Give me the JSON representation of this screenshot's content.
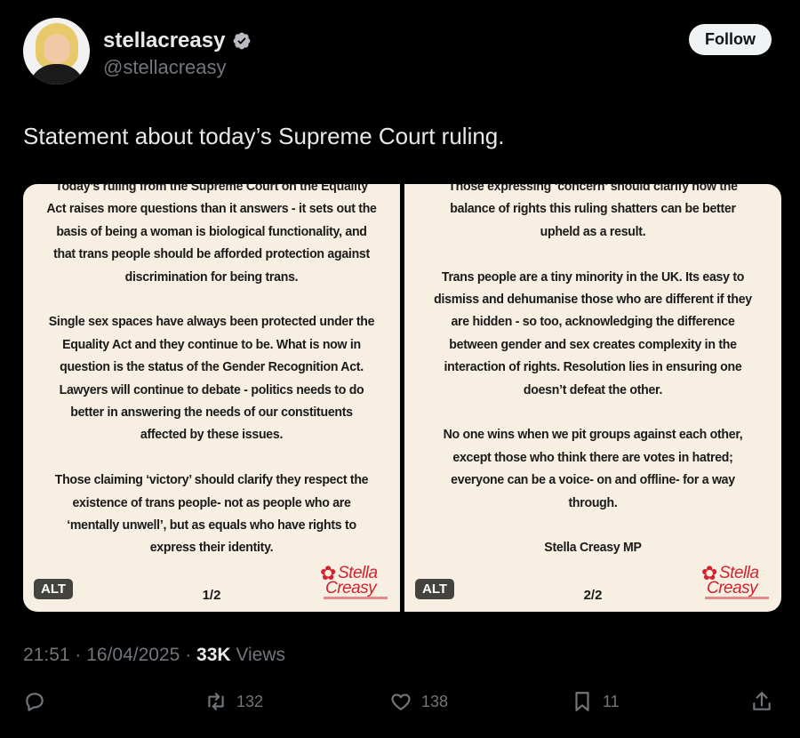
{
  "user": {
    "display_name": "stellacreasy",
    "handle": "@stellacreasy",
    "follow_label": "Follow"
  },
  "tweet": {
    "text": "Statement about today’s Supreme Court ruling.",
    "time": "21:51",
    "date": "16/04/2025",
    "views_count": "33K",
    "views_label": "Views"
  },
  "media": [
    {
      "paragraphs": [
        "Today’s ruling from the Supreme Court on the Equality\nAct raises more questions than it answers - it sets out the\nbasis of being a woman is biological functionality, and\nthat trans people should be afforded protection against\ndiscrimination for being trans.",
        "Single sex spaces have always been protected under the\nEquality Act and they continue to be. What is now in\nquestion is the status of the Gender Recognition Act.\nLawyers will continue to debate -  politics needs to do\nbetter in answering the needs of our constituents\naffected by these issues.",
        "Those claiming ‘victory’ should clarify they respect the\nexistence of trans people- not as people who are\n‘mentally unwell’, but as equals who have rights to\nexpress their identity."
      ],
      "page": "1/2",
      "alt": "ALT",
      "logo_line1": "Stella",
      "logo_line2": "Creasy"
    },
    {
      "paragraphs": [
        "Those expressing ‘concern’ should clarify how the\nbalance of rights this ruling shatters can be better\nupheld as a result.",
        "Trans people are a tiny minority in the UK. Its easy to\ndismiss and dehumanise those who are different if they\nare hidden - so too, acknowledging the difference\nbetween gender and sex creates complexity in the\ninteraction of rights. Resolution lies in ensuring one\ndoesn’t defeat the other.",
        "No one wins when we pit groups against each other,\nexcept those who think there are votes in hatred;\neveryone can be a voice- on and offline- for a way\nthrough.",
        "Stella Creasy MP"
      ],
      "page": "2/2",
      "alt": "ALT",
      "logo_line1": "Stella",
      "logo_line2": "Creasy"
    }
  ],
  "actions": {
    "reply_count": "",
    "retweet_count": "132",
    "like_count": "138",
    "bookmark_count": "11"
  },
  "icons": [
    "verified-badge-icon",
    "reply-icon",
    "retweet-icon",
    "heart-icon",
    "bookmark-icon",
    "share-icon"
  ],
  "colors": {
    "verified": "#1d9bf0",
    "muted": "#71767b",
    "background": "#000000",
    "panel": "#f6efe2",
    "logo_red": "#d4232f"
  }
}
